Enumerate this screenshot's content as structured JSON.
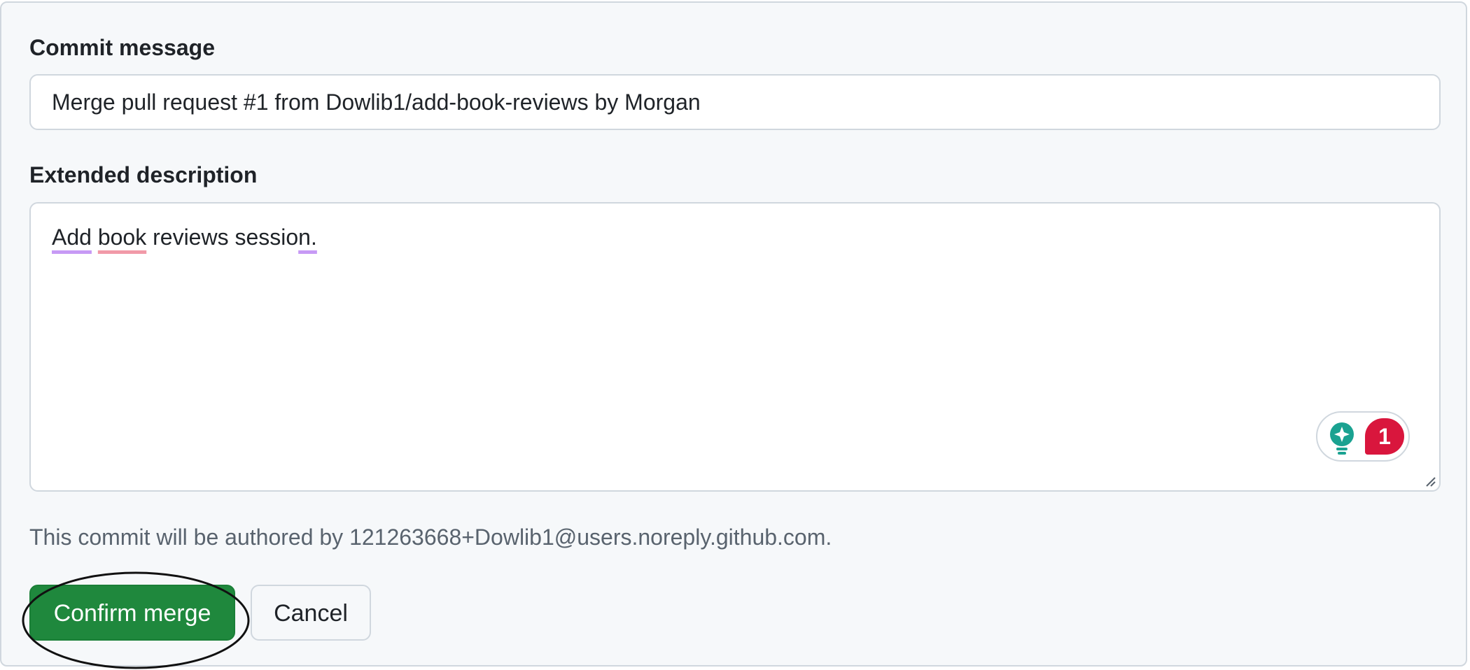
{
  "form": {
    "commit_label": "Commit message",
    "commit_value": "Merge pull request #1 from Dowlib1/add-book-reviews by Morgan",
    "extended_label": "Extended description",
    "description_words": [
      "Add",
      "book",
      "reviews",
      "session."
    ],
    "author_note": "This commit will be authored by 121263668+Dowlib1@users.noreply.github.com."
  },
  "assistant": {
    "icon": "lightbulb-sparkle-icon",
    "alert_count": "1",
    "colors": {
      "bulb": "#1aa291",
      "badge": "#d9163d"
    }
  },
  "actions": {
    "confirm_label": "Confirm merge",
    "cancel_label": "Cancel"
  },
  "colors": {
    "confirm_bg": "#1f883d",
    "panel_bg": "#f6f8fa"
  }
}
